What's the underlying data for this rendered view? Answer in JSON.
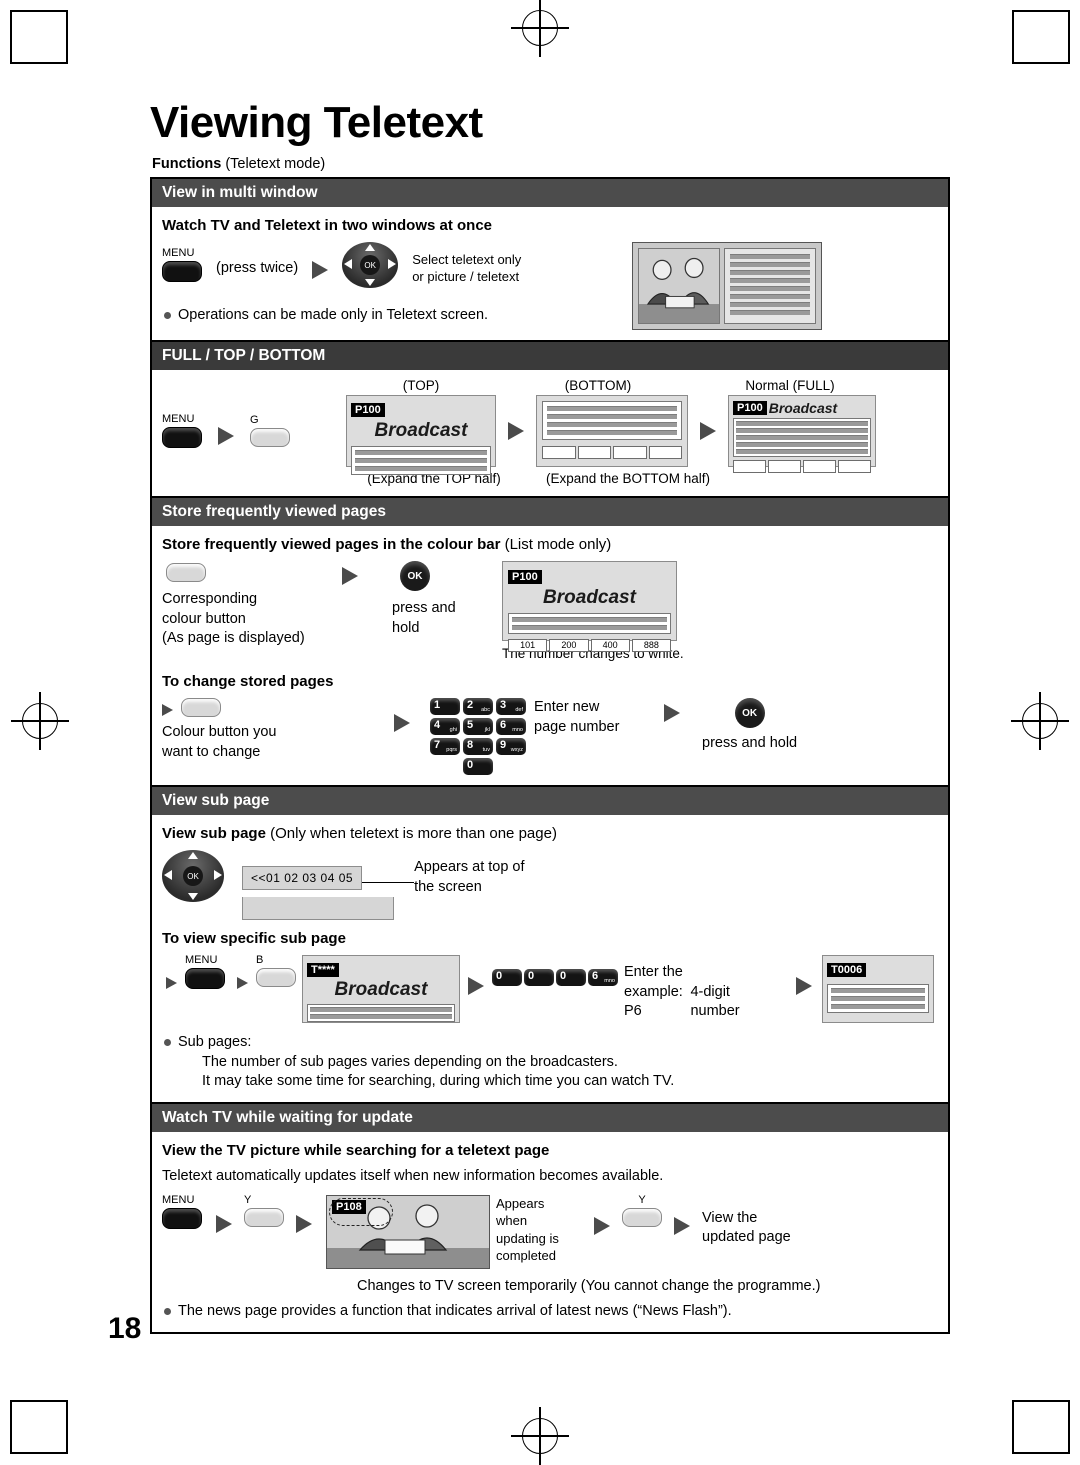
{
  "page": {
    "title": "Viewing Teletext",
    "number": "18",
    "functions_label": "Functions",
    "functions_mode": "(Teletext mode)"
  },
  "sections": {
    "multi_window": {
      "bar": "View in multi window",
      "subhead": "Watch TV and Teletext in two windows at once",
      "menu_label": "MENU",
      "press_twice": "(press twice)",
      "select_line1": "Select teletext only",
      "select_line2": "or picture / teletext",
      "note": "Operations can be made only in Teletext screen."
    },
    "full_top_bottom": {
      "bar": "FULL / TOP / BOTTOM",
      "menu_label": "MENU",
      "g_key": "G",
      "cap_top": "(TOP)",
      "cap_bottom": "(BOTTOM)",
      "cap_normal": "Normal (FULL)",
      "page_code": "P100",
      "broadcast": "Broadcast",
      "expand_top": "(Expand the TOP half)",
      "expand_bottom": "(Expand the BOTTOM half)"
    },
    "store_pages": {
      "bar": "Store frequently viewed pages",
      "subhead_bold": "Store frequently viewed pages in the colour bar",
      "subhead_reg": "(List mode only)",
      "corresponding": "Corresponding",
      "colour_button": "colour button",
      "as_displayed": "(As page is displayed)",
      "press_and": "press and",
      "hold": "hold",
      "ok_label": "OK",
      "page_code": "P100",
      "broadcast": "Broadcast",
      "colour_bar": [
        "101",
        "200",
        "400",
        "888"
      ],
      "number_white": "The number changes to white.",
      "change_head": "To change stored pages",
      "colour_button_you": "Colour button you",
      "want_to_change": "want to change",
      "enter_new": "Enter new",
      "page_number": "page number",
      "press_hold2": "press and hold",
      "numpad": [
        {
          "n": "1",
          "s": ""
        },
        {
          "n": "2",
          "s": "abc"
        },
        {
          "n": "3",
          "s": "def"
        },
        {
          "n": "4",
          "s": "ghi"
        },
        {
          "n": "5",
          "s": "jkl"
        },
        {
          "n": "6",
          "s": "mno"
        },
        {
          "n": "7",
          "s": "pqrs"
        },
        {
          "n": "8",
          "s": "tuv"
        },
        {
          "n": "9",
          "s": "wxyz"
        },
        {
          "n": "0",
          "s": ""
        }
      ]
    },
    "sub_page": {
      "bar": "View sub page",
      "subhead_bold": "View sub page",
      "subhead_reg": "(Only when teletext is more than one page)",
      "ticker": "<<01 02 03 04 05",
      "ticker_sel": "02",
      "appears1": "Appears at top of",
      "appears2": "the screen",
      "specific_head": "To view specific sub page",
      "menu_label": "MENU",
      "b_key": "B",
      "t_code": "T****",
      "broadcast": "Broadcast",
      "enter_the": "Enter the",
      "example": "example: P6",
      "four_digit": "4-digit number",
      "result_code": "T0006",
      "keys": [
        {
          "n": "0",
          "s": ""
        },
        {
          "n": "0",
          "s": ""
        },
        {
          "n": "0",
          "s": ""
        },
        {
          "n": "6",
          "s": "mno"
        }
      ],
      "note_head": "Sub pages:",
      "note1": "The number of sub pages varies depending on the broadcasters.",
      "note2": "It may take some time for searching, during which time you can watch TV."
    },
    "watch_update": {
      "bar": "Watch TV while waiting for update",
      "subhead": "View the TV picture while searching for a teletext page",
      "intro": "Teletext automatically updates itself when new information becomes available.",
      "menu_label": "MENU",
      "y_key": "Y",
      "page_code": "P108",
      "appears1": "Appears",
      "appears2": "when",
      "appears3": "updating is",
      "appears4": "completed",
      "view_the": "View the",
      "updated_page": "updated page",
      "changes_note": "Changes to TV screen temporarily (You cannot change the programme.)",
      "news_note": "The news page provides a function that indicates arrival of latest news (“News Flash”)."
    }
  }
}
